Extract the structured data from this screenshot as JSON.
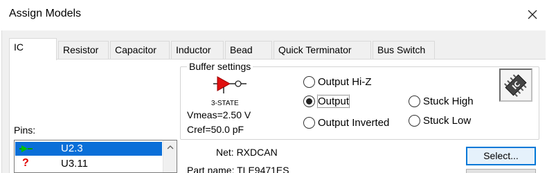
{
  "window": {
    "title": "Assign Models"
  },
  "tabs": [
    {
      "label": "IC",
      "active": true
    },
    {
      "label": "Resistor"
    },
    {
      "label": "Capacitor"
    },
    {
      "label": "Inductor"
    },
    {
      "label": "Bead"
    },
    {
      "label": "Quick Terminator"
    },
    {
      "label": "Bus Switch"
    }
  ],
  "buffer_settings": {
    "legend": "Buffer settings",
    "buffer_type": "3-STATE",
    "vmeas": "Vmeas=2.50 V",
    "cref": "Cref=50.0 pF",
    "options": {
      "output_hiz": "Output Hi-Z",
      "output": "Output",
      "output_inverted": "Output Inverted",
      "stuck_high": "Stuck High",
      "stuck_low": "Stuck Low"
    },
    "selected": "Output"
  },
  "pins": {
    "label": "Pins:",
    "items": [
      {
        "name": "U2.3",
        "status_icon": "output-pin-icon",
        "selected": true
      },
      {
        "name": "U3.11",
        "status_icon": "question-mark-icon",
        "selected": false
      }
    ]
  },
  "details": {
    "net": "Net: RXDCAN",
    "part_name": "Part name: TLE9471ES"
  },
  "buttons": {
    "select": "Select..."
  },
  "colors": {
    "selection": "#0a6fd8",
    "pin_icon": "#00a000",
    "question": "#e00000",
    "buffer_red": "#e01010"
  }
}
